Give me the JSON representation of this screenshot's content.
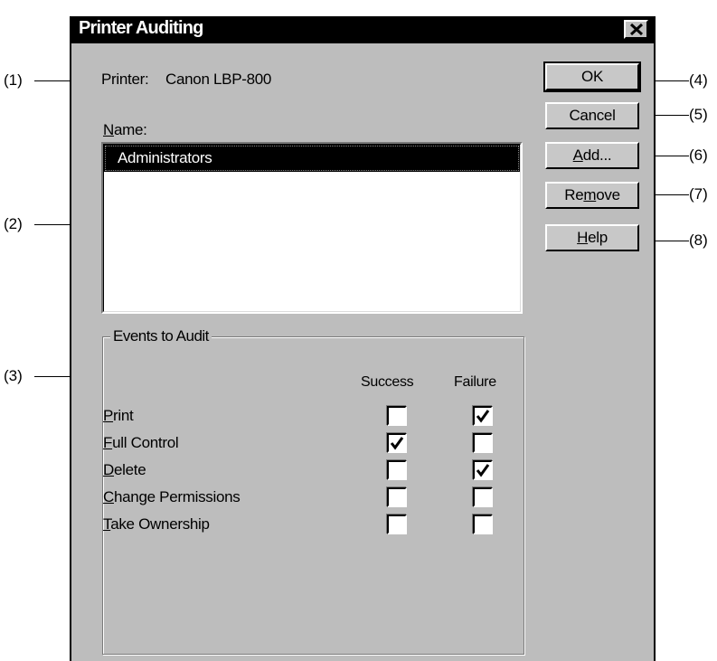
{
  "dialog": {
    "title": "Printer Auditing",
    "printer_label": "Printer:",
    "printer_name": "Canon LBP-800",
    "name_label_mnemonic": "N",
    "name_label_rest": "ame:",
    "names": [
      "Administrators"
    ],
    "events_group_title": "Events to Audit",
    "col_success": "Success",
    "col_failure": "Failure",
    "events": [
      {
        "mnemonic": "P",
        "rest": "rint",
        "success": false,
        "failure": true
      },
      {
        "mnemonic": "F",
        "rest": "ull Control",
        "success": true,
        "failure": false
      },
      {
        "mnemonic": "D",
        "rest": "elete",
        "success": false,
        "failure": true
      },
      {
        "mnemonic": "C",
        "rest": "hange Permissions",
        "success": false,
        "failure": false
      },
      {
        "mnemonic": "T",
        "rest": "ake Ownership",
        "success": false,
        "failure": false
      }
    ],
    "buttons": {
      "ok": "OK",
      "cancel": "Cancel",
      "add_mnemonic": "A",
      "add_rest": "dd...",
      "remove_pre": "Re",
      "remove_mnemonic": "m",
      "remove_rest": "ove",
      "help_mnemonic": "H",
      "help_rest": "elp"
    }
  },
  "callouts": [
    "(1)",
    "(2)",
    "(3)",
    "(4)",
    "(5)",
    "(6)",
    "(7)",
    "(8)"
  ]
}
